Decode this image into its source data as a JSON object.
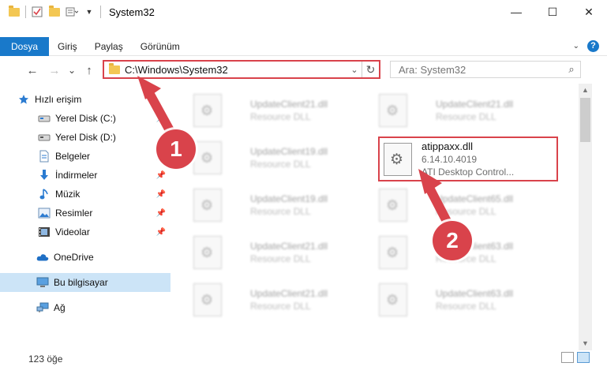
{
  "window": {
    "title": "System32",
    "minimize": "—",
    "maximize": "☐",
    "close": "✕"
  },
  "ribbon": {
    "tabs": [
      "Dosya",
      "Giriş",
      "Paylaş",
      "Görünüm"
    ],
    "help": "?"
  },
  "nav": {
    "back": "←",
    "forward": "→",
    "recent": "⌄",
    "up": "↑"
  },
  "address": {
    "path": "C:\\Windows\\System32",
    "refresh": "↻"
  },
  "search": {
    "placeholder": "Ara: System32",
    "icon": "⌕"
  },
  "sidebar": {
    "items": [
      {
        "label": "Hızlı erişim",
        "icon": "star-icon"
      },
      {
        "label": "Yerel Disk (C:)",
        "icon": "drive-icon"
      },
      {
        "label": "Yerel Disk (D:)",
        "icon": "drive-icon"
      },
      {
        "label": "Belgeler",
        "icon": "document-icon"
      },
      {
        "label": "İndirmeler",
        "icon": "download-icon"
      },
      {
        "label": "Müzik",
        "icon": "music-icon"
      },
      {
        "label": "Resimler",
        "icon": "pictures-icon"
      },
      {
        "label": "Videolar",
        "icon": "video-icon"
      },
      {
        "label": "OneDrive",
        "icon": "cloud-icon"
      },
      {
        "label": "Bu bilgisayar",
        "icon": "computer-icon"
      },
      {
        "label": "Ağ",
        "icon": "network-icon"
      }
    ]
  },
  "files": [
    {
      "name": "UpdateClient21.dll",
      "type": "Resource DLL"
    },
    {
      "name": "UpdateClient21.dll",
      "type": "Resource DLL"
    },
    {
      "name": "UpdateClient19.dll",
      "type": "Resource DLL"
    },
    {
      "name": "UpdateClient19.dll",
      "type": "Resource DLL"
    },
    {
      "name": "UpdateClient65.dll",
      "type": "Resource DLL"
    },
    {
      "name": "UpdateClient21.dll",
      "type": "Resource DLL"
    },
    {
      "name": "UpdateClient63.dll",
      "type": "Resource DLL"
    },
    {
      "name": "UpdateClient21.dll",
      "type": "Resource DLL"
    },
    {
      "name": "UpdateClient63.dll",
      "type": "Resource DLL"
    }
  ],
  "highlighted_file": {
    "name": "atippaxx.dll",
    "version": "6.14.10.4019",
    "description": "ATI Desktop Control..."
  },
  "status": {
    "count": "123 öğe"
  },
  "annotations": {
    "step1": "1",
    "step2": "2",
    "color": "#d9434b"
  }
}
